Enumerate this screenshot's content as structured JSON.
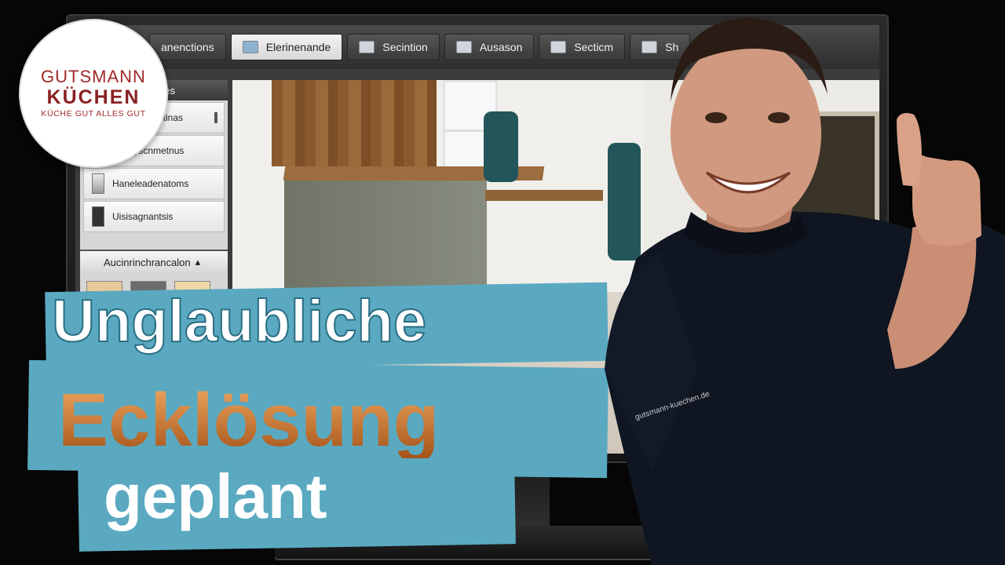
{
  "logo": {
    "line1": "GUTSMANN",
    "line2": "KÜCHEN",
    "line3": "KÜCHE GUT ALLES GUT",
    "color": "#8a2222"
  },
  "toolbar": {
    "tabs": [
      {
        "label": "anenctions",
        "icon": "window-icon",
        "active": false
      },
      {
        "label": "Elerinenande",
        "icon": "window-icon",
        "active": true
      },
      {
        "label": "Secintion",
        "icon": "panel-icon",
        "active": false
      },
      {
        "label": "Ausason",
        "icon": "building-icon",
        "active": false
      },
      {
        "label": "Secticm",
        "icon": "cabinet-icon",
        "active": false
      },
      {
        "label": "Sh",
        "icon": "image-icon",
        "active": false
      }
    ],
    "play_icon": "play-icon",
    "caret_icon": "chevron-down-icon"
  },
  "sidebar": {
    "header": "nes",
    "items": [
      {
        "label": "Sitinas"
      },
      {
        "label": "Finroyscnmetnus"
      },
      {
        "label": "Haneleadenatoms"
      },
      {
        "label": "Uisisagnantsis"
      }
    ],
    "section2": "Aucinrinchrancalon"
  },
  "headline": {
    "line1": "Unglaubliche",
    "line2": "Ecklösung",
    "line3": "geplant"
  },
  "shirt_text": "gutsmann-kuechen.de",
  "colors": {
    "banner": "#5aa9c1",
    "accent_orange": "#b86a22",
    "logo_red": "#8a2222"
  }
}
